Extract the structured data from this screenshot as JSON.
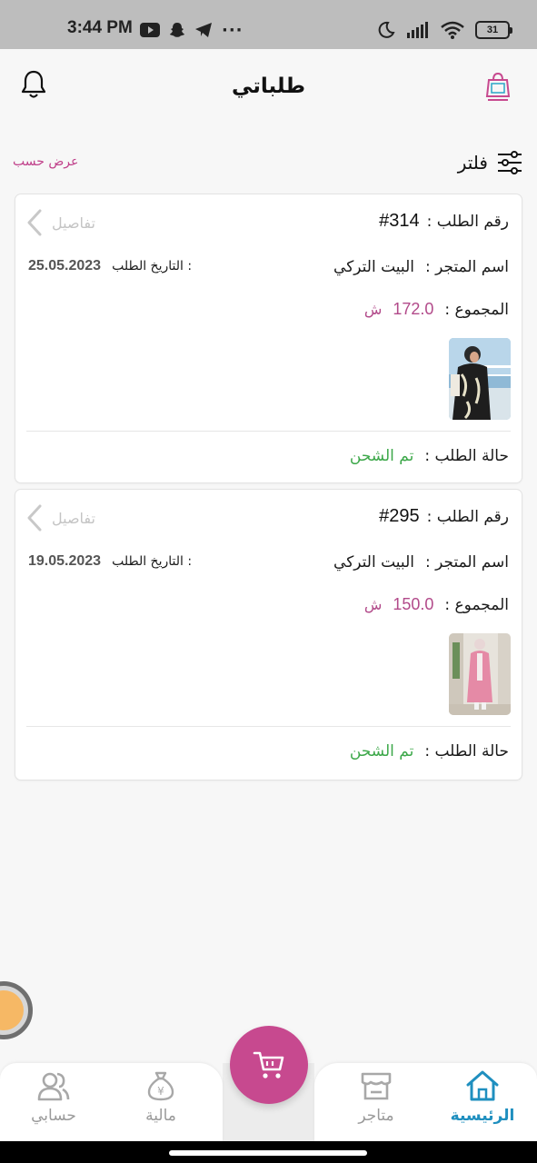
{
  "status_bar": {
    "time": "3:44 PM",
    "battery": "31",
    "more": "···"
  },
  "header": {
    "title": "طلباتي"
  },
  "filter": {
    "label": "فلتر",
    "sort_label": "عرض حسب"
  },
  "labels": {
    "order_number": "رقم الطلب :",
    "store_name": "اسم المتجر :",
    "order_date": "التاريخ الطلب :",
    "total": "المجموع :",
    "status": "حالة الطلب :",
    "details": "تفاصيل",
    "currency": "ش"
  },
  "orders": [
    {
      "number": "#314",
      "store": "البيت التركي",
      "date": "25.05.2023",
      "total": "172.0",
      "status": "تم الشحن"
    },
    {
      "number": "#295",
      "store": "البيت التركي",
      "date": "19.05.2023",
      "total": "150.0",
      "status": "تم الشحن"
    }
  ],
  "bottom_nav": {
    "home": "الرئيسية",
    "stores": "متاجر",
    "finance": "مالية",
    "account": "حسابي"
  },
  "colors": {
    "accent": "#c7498f",
    "price": "#b24a8a",
    "status_shipped": "#3da84a",
    "nav_active": "#1f8fbf"
  }
}
